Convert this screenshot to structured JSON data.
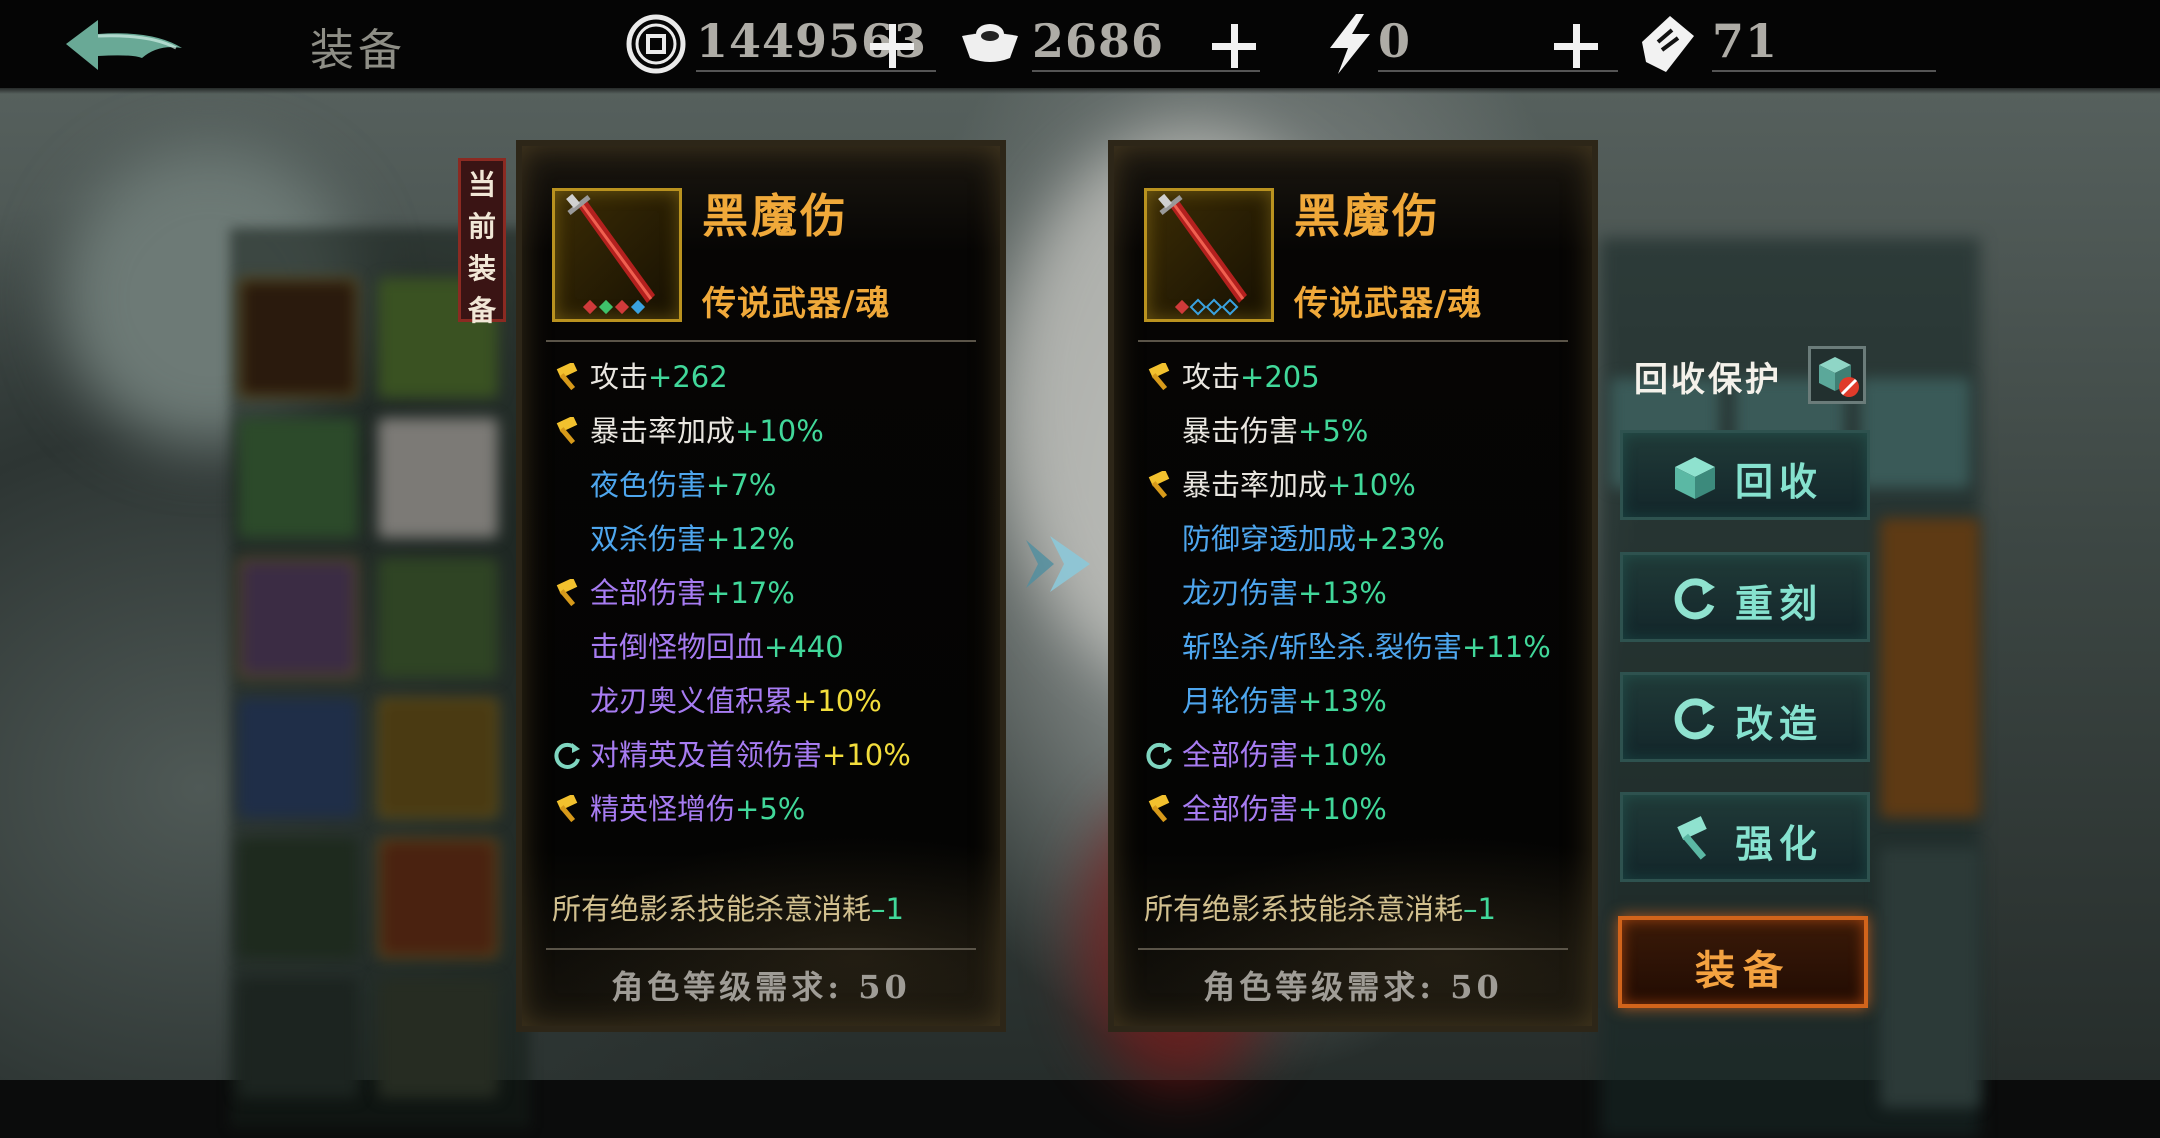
{
  "topbar": {
    "title": "装备",
    "resources": [
      {
        "icon": "coin-icon",
        "value": "1449563"
      },
      {
        "icon": "silver-ingot-icon",
        "value": "2686"
      },
      {
        "icon": "lightning-icon",
        "value": "0"
      },
      {
        "icon": "ticket-icon",
        "value": "71"
      }
    ]
  },
  "current_tag": [
    "当",
    "前",
    "装",
    "备"
  ],
  "left_panel": {
    "name": "黑魔伤",
    "type": "传说武器/魂",
    "stats": [
      {
        "marker": "hammer",
        "label": "攻击",
        "value": "+262",
        "label_color": "white",
        "value_color": "green"
      },
      {
        "marker": "hammer",
        "label": "暴击率加成",
        "value": "+10%",
        "label_color": "white",
        "value_color": "green"
      },
      {
        "marker": "",
        "label": "夜色伤害",
        "value": "+7%",
        "label_color": "blue",
        "value_color": "green"
      },
      {
        "marker": "",
        "label": "双杀伤害",
        "value": "+12%",
        "label_color": "blue",
        "value_color": "green"
      },
      {
        "marker": "hammer",
        "label": "全部伤害",
        "value": "+17%",
        "label_color": "purple",
        "value_color": "green"
      },
      {
        "marker": "",
        "label": "击倒怪物回血",
        "value": "+440",
        "label_color": "purple",
        "value_color": "green"
      },
      {
        "marker": "",
        "label": "龙刃奥义值积累",
        "value": "+10%",
        "label_color": "purple",
        "value_color": "yellow"
      },
      {
        "marker": "refresh",
        "label": "对精英及首领伤害",
        "value": "+10%",
        "label_color": "purple",
        "value_color": "yellow"
      },
      {
        "marker": "hammer",
        "label": "精英怪增伤",
        "value": "+5%",
        "label_color": "purple",
        "value_color": "green"
      }
    ],
    "passive_text": "所有绝影系技能杀意消耗",
    "passive_value": "–1",
    "requirement": "角色等级需求: 50"
  },
  "right_panel": {
    "name": "黑魔伤",
    "type": "传说武器/魂",
    "stats": [
      {
        "marker": "hammer",
        "label": "攻击",
        "value": "+205",
        "label_color": "white",
        "value_color": "green"
      },
      {
        "marker": "",
        "label": "暴击伤害",
        "value": "+5%",
        "label_color": "white",
        "value_color": "green"
      },
      {
        "marker": "hammer",
        "label": "暴击率加成",
        "value": "+10%",
        "label_color": "white",
        "value_color": "green"
      },
      {
        "marker": "",
        "label": "防御穿透加成",
        "value": "+23%",
        "label_color": "blue",
        "value_color": "green"
      },
      {
        "marker": "",
        "label": "龙刃伤害",
        "value": "+13%",
        "label_color": "blue",
        "value_color": "green"
      },
      {
        "marker": "",
        "label": "斩坠杀/斩坠杀.裂伤害",
        "value": "+11%",
        "label_color": "blue",
        "value_color": "green"
      },
      {
        "marker": "",
        "label": "月轮伤害",
        "value": "+13%",
        "label_color": "blue",
        "value_color": "green"
      },
      {
        "marker": "refresh",
        "label": "全部伤害",
        "value": "+10%",
        "label_color": "purple",
        "value_color": "green"
      },
      {
        "marker": "hammer",
        "label": "全部伤害",
        "value": "+10%",
        "label_color": "purple",
        "value_color": "green"
      }
    ],
    "passive_text": "所有绝影系技能杀意消耗",
    "passive_value": "–1",
    "requirement": "角色等级需求: 50"
  },
  "actions": {
    "protect_label": "回收保护",
    "recycle": "回收",
    "reforge": "重刻",
    "modify": "改造",
    "enhance": "强化",
    "equip": "装备"
  },
  "colors": {
    "white": "#e9e6e0",
    "blue": "#4ea6ee",
    "purple": "#a77cf2",
    "green": "#41d89a",
    "yellow": "#f2dd3c",
    "gold": "#f0a93a",
    "teal": "#86e2cf",
    "orange": "#f4a240"
  }
}
